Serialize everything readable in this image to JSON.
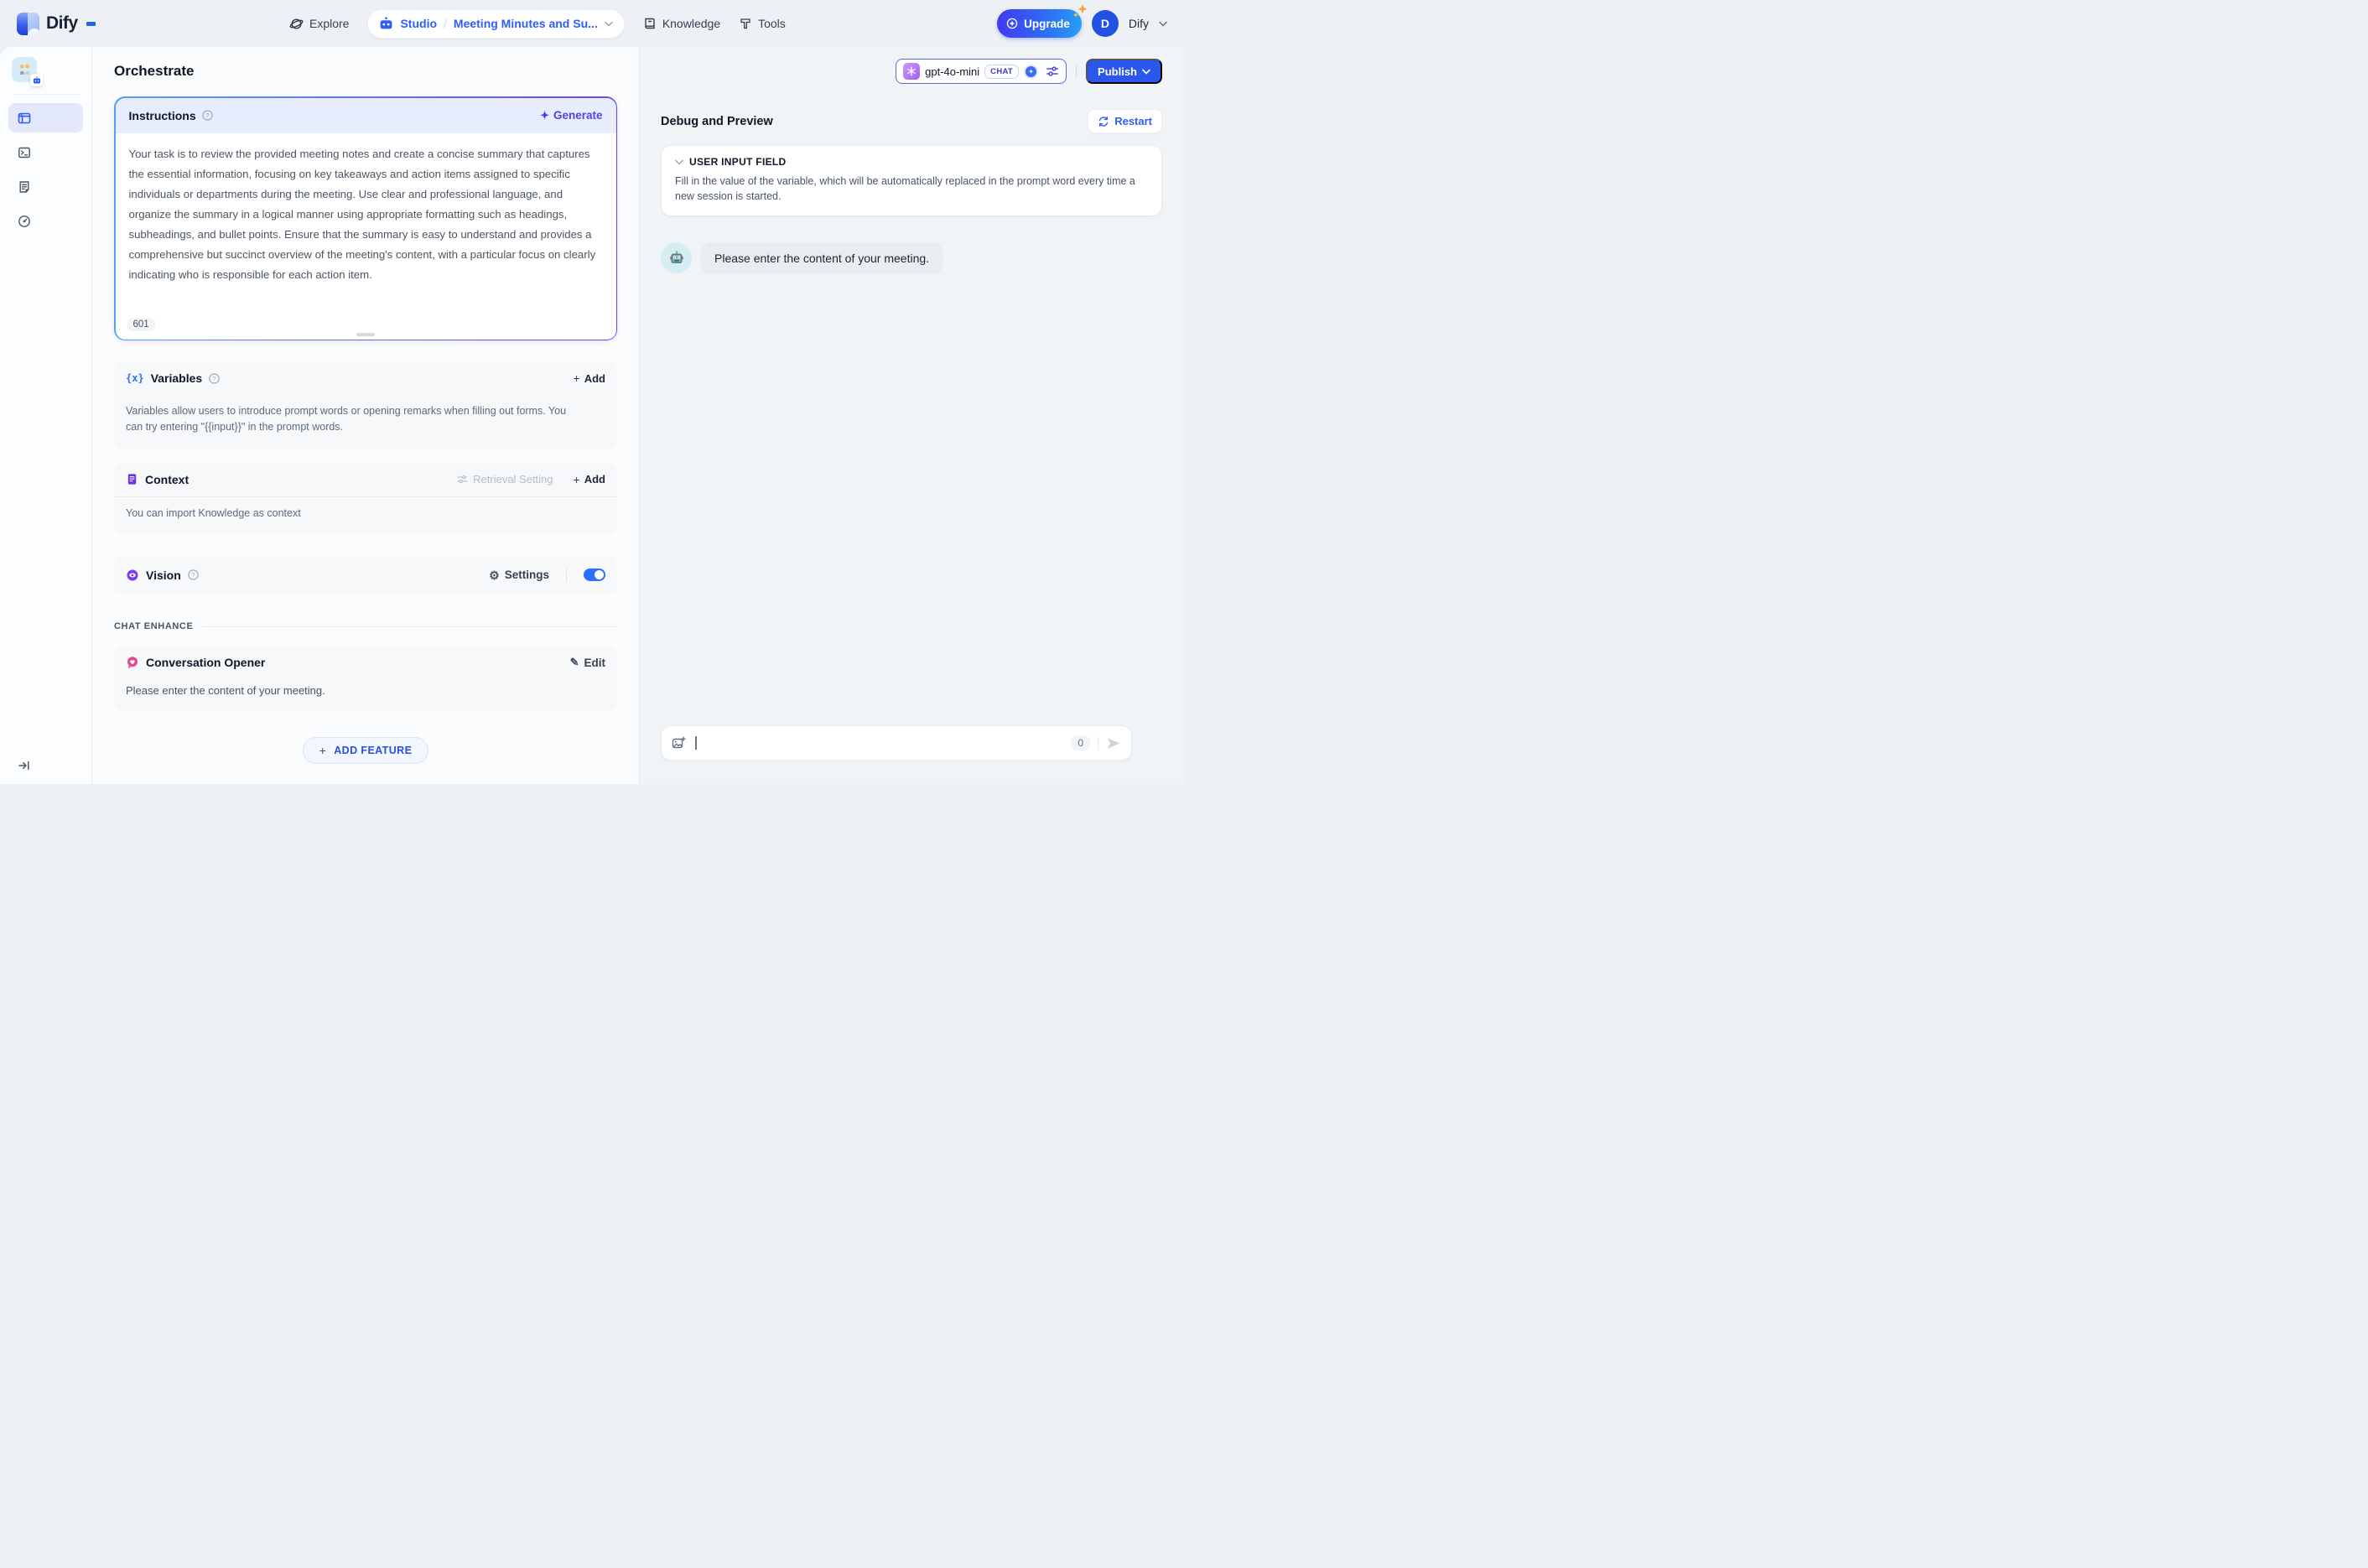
{
  "header": {
    "logo_text": "Dify",
    "nav": {
      "explore": "Explore",
      "studio": "Studio",
      "app_name": "Meeting Minutes and Su...",
      "knowledge": "Knowledge",
      "tools": "Tools"
    },
    "upgrade_label": "Upgrade",
    "account": {
      "avatar_initial": "D",
      "name": "Dify"
    }
  },
  "toolbar": {
    "page_title": "Orchestrate",
    "model": {
      "name": "gpt-4o-mini",
      "mode_badge": "CHAT"
    },
    "publish_label": "Publish"
  },
  "config": {
    "instructions": {
      "title": "Instructions",
      "generate_label": "Generate",
      "text": "Your task is to review the provided meeting notes and create a concise summary that captures the essential information, focusing on key takeaways and action items assigned to specific individuals or departments during the meeting. Use clear and professional language, and organize the summary in a logical manner using appropriate formatting such as headings, subheadings, and bullet points. Ensure that the summary is easy to understand and provides a comprehensive but succinct overview of the meeting's content, with a particular focus on clearly indicating who is responsible for each action item.",
      "char_count": "601"
    },
    "variables": {
      "title": "Variables",
      "add_label": "Add",
      "description": "Variables allow users to introduce prompt words or opening remarks when filling out forms. You can try entering \"{{input}}\" in the prompt words."
    },
    "context": {
      "title": "Context",
      "retrieval_setting_label": "Retrieval Setting",
      "add_label": "Add",
      "description": "You can import Knowledge as context"
    },
    "vision": {
      "title": "Vision",
      "settings_label": "Settings",
      "enabled": true
    },
    "chat_enhance_label": "CHAT ENHANCE",
    "conversation_opener": {
      "title": "Conversation Opener",
      "edit_label": "Edit",
      "text": "Please enter the content of your meeting."
    },
    "add_feature_label": "ADD FEATURE"
  },
  "debug": {
    "title": "Debug and Preview",
    "restart_label": "Restart",
    "user_input_field": {
      "title": "USER INPUT FIELD",
      "description": "Fill in the value of the variable, which will be automatically replaced in the prompt word every time a new session is started."
    },
    "messages": [
      {
        "role": "assistant",
        "text": "Please enter the content of your meeting."
      }
    ],
    "input": {
      "char_count": "0"
    }
  },
  "icons": {
    "gear": "⚙",
    "pencil": "✎",
    "spark": "✦",
    "variables": "{x}",
    "plus": "+",
    "gem": "✦"
  },
  "colors": {
    "accent_blue": "#2d5ef6",
    "indigo": "#4f46e5",
    "purple": "#7a3bec",
    "pink": "#e74694",
    "toggle_on": "#2970ff",
    "publish_blue": "#2b57eb"
  }
}
